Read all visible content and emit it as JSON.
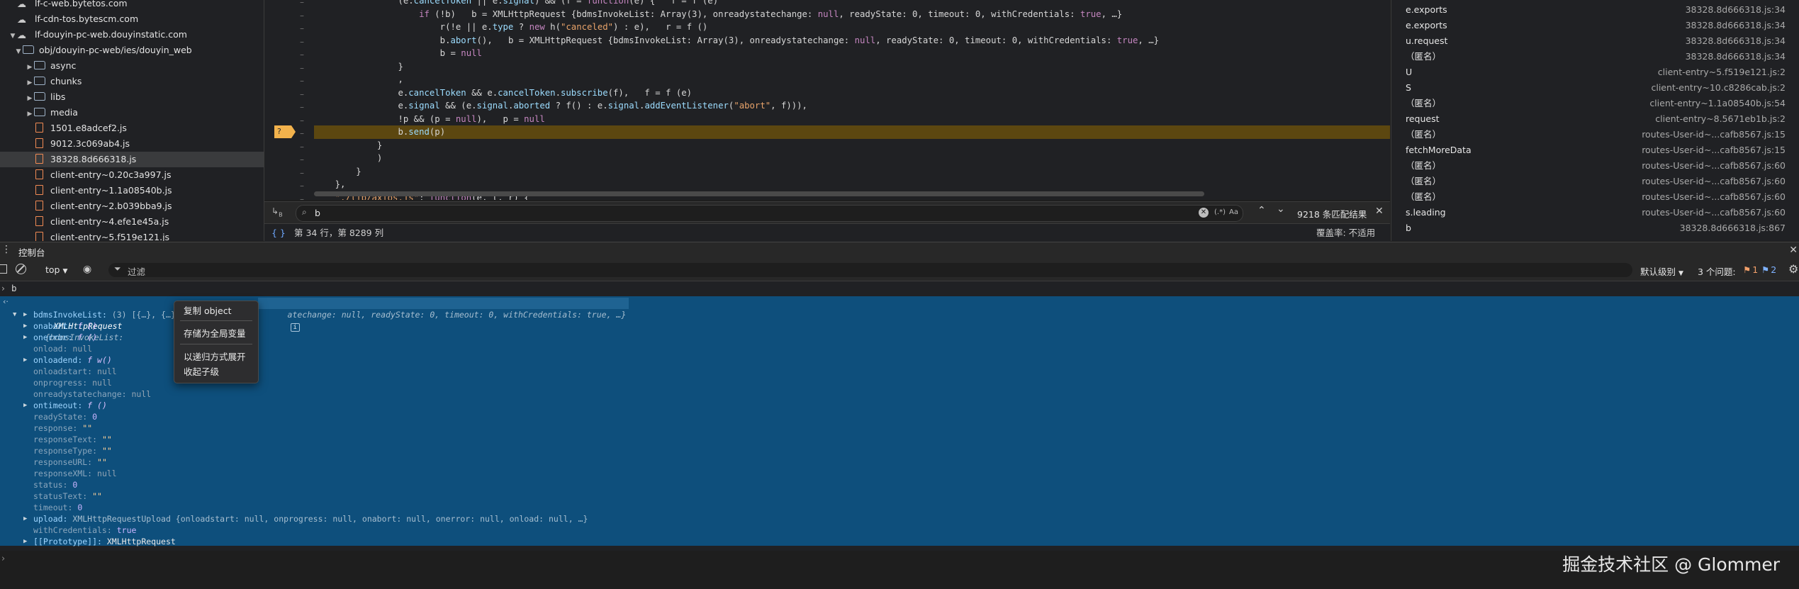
{
  "file_tree": {
    "items": [
      {
        "label": "lf-c-web.bytetos.com",
        "type": "cloud",
        "level": 1
      },
      {
        "label": "lf-cdn-tos.bytescm.com",
        "type": "cloud",
        "level": 1
      },
      {
        "label": "lf-douyin-pc-web.douyinstatic.com",
        "type": "cloud",
        "level": 1,
        "expanded": true
      },
      {
        "label": "obj/douyin-pc-web/ies/douyin_web",
        "type": "folder",
        "level": 2,
        "expanded": true
      },
      {
        "label": "async",
        "type": "folder",
        "level": 3
      },
      {
        "label": "chunks",
        "type": "folder",
        "level": 3
      },
      {
        "label": "libs",
        "type": "folder",
        "level": 3
      },
      {
        "label": "media",
        "type": "folder",
        "level": 3
      },
      {
        "label": "1501.e8adcef2.js",
        "type": "file",
        "level": 3
      },
      {
        "label": "9012.3c069ab4.js",
        "type": "file",
        "level": 3
      },
      {
        "label": "38328.8d666318.js",
        "type": "file",
        "level": 3,
        "selected": true
      },
      {
        "label": "client-entry~0.20c3a997.js",
        "type": "file",
        "level": 3
      },
      {
        "label": "client-entry~1.1a08540b.js",
        "type": "file",
        "level": 3
      },
      {
        "label": "client-entry~2.b039bba9.js",
        "type": "file",
        "level": 3
      },
      {
        "label": "client-entry~4.efe1e45a.js",
        "type": "file",
        "level": 3
      },
      {
        "label": "client-entry~5.f519e121.js",
        "type": "file",
        "level": 3
      }
    ]
  },
  "editor": {
    "breakpoint_label": "?",
    "lines": [
      "                (e.cancelToken || e.signal) && (f = function(e) {   f = f (e)",
      "                    if (!b)   b = XMLHttpRequest {bdmsInvokeList: Array(3), onreadystatechange: null, readyState: 0, timeout: 0, withCredentials: true, …}",
      "                        r(!e || e.type ? new h(\"canceled\") : e),   r = f ()",
      "                        b.abort(),   b = XMLHttpRequest {bdmsInvokeList: Array(3), onreadystatechange: null, readyState: 0, timeout: 0, withCredentials: true, …}",
      "                        b = null",
      "                }",
      "                ,",
      "                e.cancelToken && e.cancelToken.subscribe(f),   f = f (e)",
      "                e.signal && (e.signal.aborted ? f() : e.signal.addEventListener(\"abort\", f))),",
      "                !p && (p = null),   p = null",
      "                b.send(p)",
      "            }",
      "            )",
      "        }",
      "    },",
      "    \"./lib/axios.js\": function(e, t, r) {",
      "        \"use strict\";"
    ]
  },
  "search": {
    "value": "b",
    "regex_label": "(.*)",
    "case_label": "Aa",
    "result_count": "9218 条匹配结果"
  },
  "status": {
    "position": "第 34 行，第 8289 列",
    "coverage": "覆盖率: 不适用"
  },
  "call_stack": [
    {
      "name": "e.exports",
      "loc": "38328.8d666318.js:34"
    },
    {
      "name": "e.exports",
      "loc": "38328.8d666318.js:34"
    },
    {
      "name": "u.request",
      "loc": "38328.8d666318.js:34"
    },
    {
      "name": "（匿名）",
      "loc": "38328.8d666318.js:34"
    },
    {
      "name": "U",
      "loc": "client-entry~5.f519e121.js:2"
    },
    {
      "name": "S",
      "loc": "client-entry~10.c8286cab.js:2"
    },
    {
      "name": "（匿名）",
      "loc": "client-entry~1.1a08540b.js:54"
    },
    {
      "name": "request",
      "loc": "client-entry~8.5671eb1b.js:2"
    },
    {
      "name": "（匿名）",
      "loc": "routes-User-id~...cafb8567.js:15"
    },
    {
      "name": "fetchMoreData",
      "loc": "routes-User-id~...cafb8567.js:15"
    },
    {
      "name": "（匿名）",
      "loc": "routes-User-id~...cafb8567.js:60"
    },
    {
      "name": "（匿名）",
      "loc": "routes-User-id~...cafb8567.js:60"
    },
    {
      "name": "（匿名）",
      "loc": "routes-User-id~...cafb8567.js:60"
    },
    {
      "name": "s.leading",
      "loc": "routes-User-id~...cafb8567.js:60"
    },
    {
      "name": "b",
      "loc": "38328.8d666318.js:867"
    }
  ],
  "console": {
    "tab_label": "控制台",
    "context_label": "top",
    "filter_placeholder": "过滤",
    "level_label": "默认级别",
    "issues_label": "3 个问题:",
    "issue_warn_count": "1",
    "issue_info_count": "2",
    "input_echo": "b",
    "object_header_name": "XMLHttpRequest",
    "object_header_preview": "{bdmsInvokeList:",
    "object_header_tail": "atechange: null, readyState: 0, timeout: 0, withCredentials: true, …}",
    "info_badge": "i",
    "lines": [
      {
        "key": "bdmsInvokeList",
        "val": "(3) [{…}, {…},",
        "expandable": true,
        "kind": "dim"
      },
      {
        "key": "onabort",
        "val": "f ()",
        "expandable": true,
        "kind": "fn"
      },
      {
        "key": "onerror",
        "val": "f ()",
        "expandable": true,
        "kind": "fn"
      },
      {
        "key": "onload",
        "val": "null",
        "expandable": false,
        "kind": "null"
      },
      {
        "key": "onloadend",
        "val": "f w()",
        "expandable": true,
        "kind": "fn"
      },
      {
        "key": "onloadstart",
        "val": "null",
        "expandable": false,
        "kind": "null"
      },
      {
        "key": "onprogress",
        "val": "null",
        "expandable": false,
        "kind": "null"
      },
      {
        "key": "onreadystatechange",
        "val": "null",
        "expandable": false,
        "kind": "null"
      },
      {
        "key": "ontimeout",
        "val": "f ()",
        "expandable": true,
        "kind": "fn"
      },
      {
        "key": "readyState",
        "val": "0",
        "expandable": false,
        "kind": "num"
      },
      {
        "key": "response",
        "val": "\"\"",
        "expandable": false,
        "kind": "str"
      },
      {
        "key": "responseText",
        "val": "\"\"",
        "expandable": false,
        "kind": "str"
      },
      {
        "key": "responseType",
        "val": "\"\"",
        "expandable": false,
        "kind": "str"
      },
      {
        "key": "responseURL",
        "val": "\"\"",
        "expandable": false,
        "kind": "str"
      },
      {
        "key": "responseXML",
        "val": "null",
        "expandable": false,
        "kind": "null"
      },
      {
        "key": "status",
        "val": "0",
        "expandable": false,
        "kind": "num"
      },
      {
        "key": "statusText",
        "val": "\"\"",
        "expandable": false,
        "kind": "str"
      },
      {
        "key": "timeout",
        "val": "0",
        "expandable": false,
        "kind": "num"
      },
      {
        "key": "upload",
        "val": "XMLHttpRequestUpload {onloadstart: null, onprogress: null, onabort: null, onerror: null, onload: null, …}",
        "expandable": true,
        "kind": "dim"
      },
      {
        "key": "withCredentials",
        "val": "true",
        "expandable": false,
        "kind": "num"
      },
      {
        "key": "[[Prototype]]",
        "val": "XMLHttpRequest",
        "expandable": true,
        "kind": "plain"
      }
    ]
  },
  "context_menu": {
    "items": [
      "复制 object",
      "存储为全局变量",
      "以递归方式展开",
      "收起子级"
    ]
  },
  "watermark": "掘金技术社区 @ Glommer",
  "colors": {
    "accent": "#0e4f7c",
    "paused_line": "#5c4710",
    "breakpoint": "#f2b24c"
  }
}
